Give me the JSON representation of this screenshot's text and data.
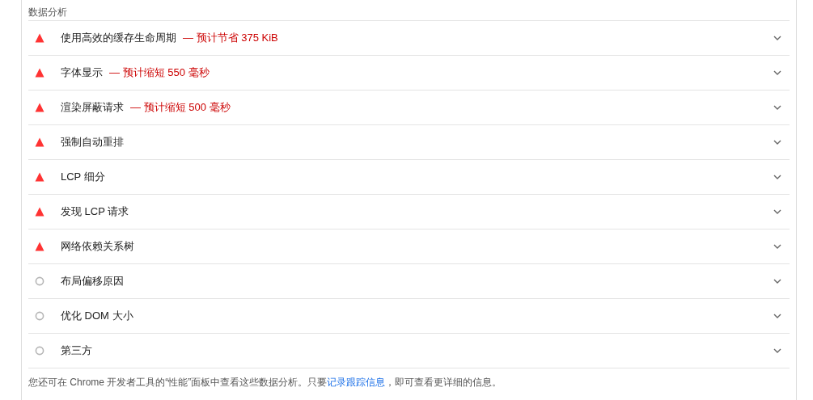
{
  "section_title": "数据分析",
  "insights": [
    {
      "kind": "fail",
      "title": "使用高效的缓存生命周期",
      "savings": "— 预计节省 375 KiB",
      "expanded": false
    },
    {
      "kind": "fail",
      "title": "字体显示",
      "savings": "— 预计缩短 550 毫秒",
      "expanded": false
    },
    {
      "kind": "fail",
      "title": "渲染屏蔽请求",
      "savings": "— 预计缩短 500 毫秒",
      "expanded": false
    },
    {
      "kind": "fail",
      "title": "强制自动重排",
      "expanded": false
    },
    {
      "kind": "fail",
      "title": "LCP 细分",
      "expanded": false
    },
    {
      "kind": "fail",
      "title": "发现 LCP 请求",
      "expanded": false
    },
    {
      "kind": "fail",
      "title": "网络依赖关系树",
      "expanded": false
    },
    {
      "kind": "info",
      "title": "布局偏移原因",
      "expanded": false
    },
    {
      "kind": "info",
      "title": "优化 DOM 大小",
      "expanded": false
    },
    {
      "kind": "info",
      "title": "第三方",
      "expanded": false
    }
  ],
  "footer": {
    "before": "您还可在 Chrome 开发者工具的“性能”面板中查看这些数据分析。只要",
    "link": "记录跟踪信息",
    "after": "，即可查看更详细的信息。"
  }
}
